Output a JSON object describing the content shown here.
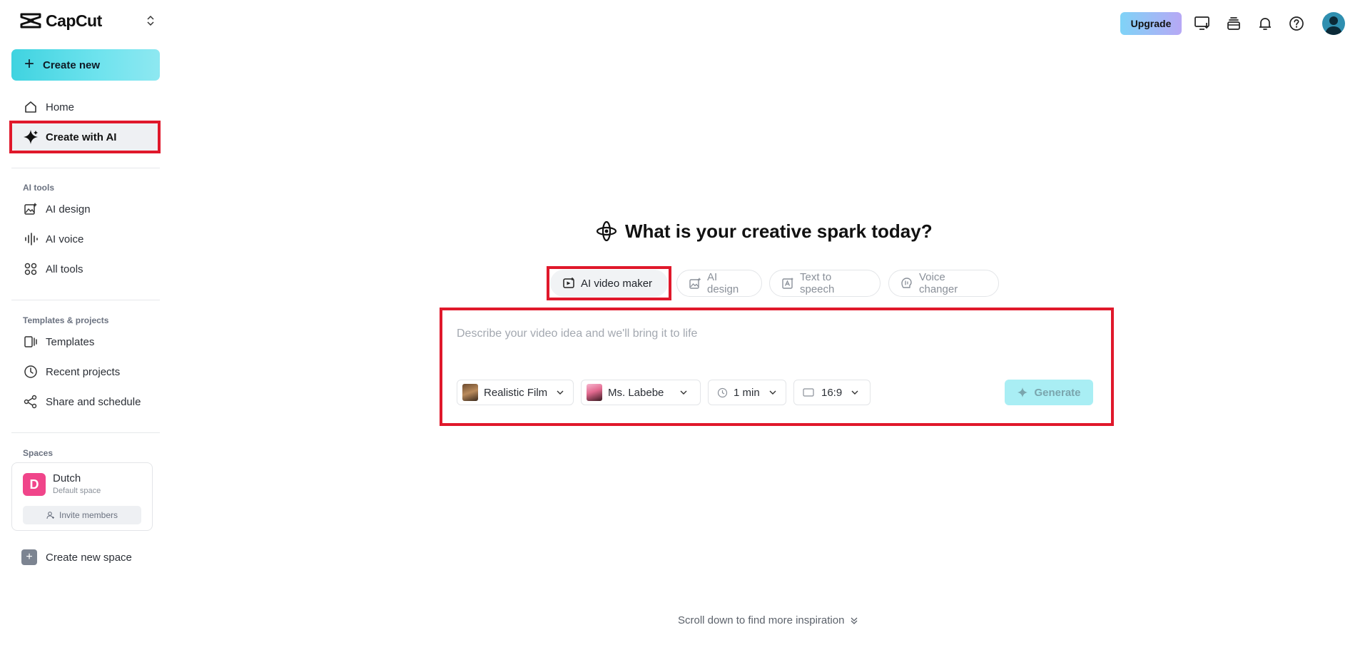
{
  "brand": {
    "name": "CapCut"
  },
  "sidebar": {
    "create_new": "Create new",
    "nav": [
      {
        "label": "Home",
        "icon": "home-icon"
      },
      {
        "label": "Create with AI",
        "icon": "sparkle-icon"
      }
    ],
    "ai_tools": {
      "heading": "AI tools",
      "items": [
        {
          "label": "AI design",
          "icon": "image-sparkle-icon"
        },
        {
          "label": "AI voice",
          "icon": "audio-wave-icon"
        },
        {
          "label": "All tools",
          "icon": "grid-icon"
        }
      ]
    },
    "templates_projects": {
      "heading": "Templates & projects",
      "items": [
        {
          "label": "Templates",
          "icon": "template-icon"
        },
        {
          "label": "Recent projects",
          "icon": "clock-icon"
        },
        {
          "label": "Share and schedule",
          "icon": "share-icon"
        }
      ]
    },
    "spaces": {
      "heading": "Spaces",
      "space": {
        "initial": "D",
        "name": "Dutch",
        "subtitle": "Default space",
        "color": "#f0458a"
      },
      "invite_label": "Invite members"
    },
    "create_space": "Create new space"
  },
  "topbar": {
    "upgrade": "Upgrade",
    "icons": [
      "desktop-download-icon",
      "stack-icon",
      "bell-icon",
      "help-icon",
      "user-avatar-icon"
    ]
  },
  "main": {
    "title": "What is your creative spark today?",
    "tabs": [
      {
        "label": "AI video maker",
        "icon": "video-add-icon"
      },
      {
        "label": "AI design",
        "icon": "image-sparkle-icon"
      },
      {
        "label": "Text to speech",
        "icon": "text-speech-icon"
      },
      {
        "label": "Voice changer",
        "icon": "voice-changer-icon"
      }
    ],
    "prompt_placeholder": "Describe your video idea and we'll bring it to life",
    "options": {
      "style": "Realistic Film",
      "voice": "Ms. Labebe",
      "duration": "1 min",
      "ratio": "16:9"
    },
    "generate": "Generate",
    "scroll_hint": "Scroll down to find more inspiration"
  },
  "colors": {
    "accent": "#3fd3e0",
    "highlight": "#e0182b"
  }
}
